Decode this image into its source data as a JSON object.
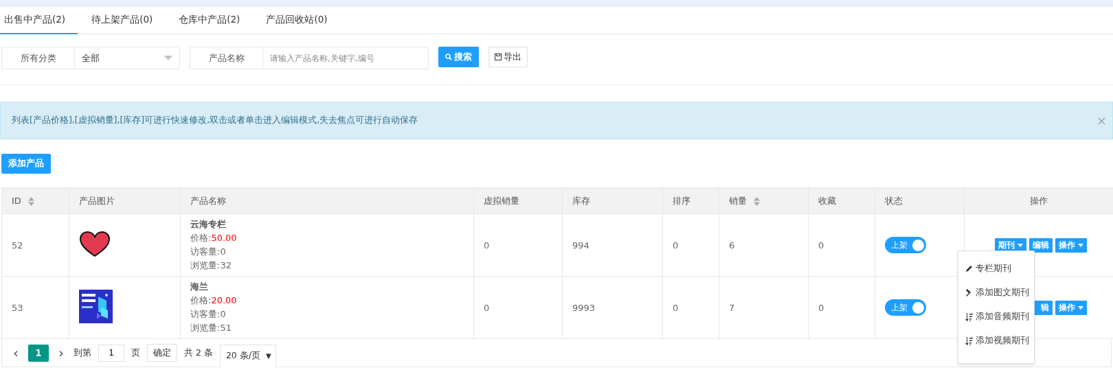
{
  "tabs": [
    {
      "label": "出售中产品(2)",
      "selected": true
    },
    {
      "label": "待上架产品(0)",
      "selected": false
    },
    {
      "label": "仓库中产品(2)",
      "selected": false
    },
    {
      "label": "产品回收站(0)",
      "selected": false
    }
  ],
  "filters": {
    "category_label": "所有分类",
    "category_value": "全部",
    "name_label": "产品名称",
    "name_placeholder": "请输入产品名称,关键字,编号",
    "search_button": "搜索",
    "export_button": "导出"
  },
  "alert": {
    "text": "列表[产品价格],[虚拟销量],[库存]可进行快速修改,双击或者单击进入编辑模式,失去焦点可进行自动保存",
    "close": "×"
  },
  "add_button": "添加产品",
  "table": {
    "columns": [
      {
        "label": "ID",
        "sortable": true
      },
      {
        "label": "产品图片",
        "sortable": false
      },
      {
        "label": "产品名称",
        "sortable": false
      },
      {
        "label": "虚拟销量",
        "sortable": false
      },
      {
        "label": "库存",
        "sortable": false
      },
      {
        "label": "排序",
        "sortable": false
      },
      {
        "label": "销量",
        "sortable": true
      },
      {
        "label": "收藏",
        "sortable": false
      },
      {
        "label": "状态",
        "sortable": false
      },
      {
        "label": "操作",
        "sortable": false
      }
    ],
    "rows": [
      {
        "id": "52",
        "title": "云海专栏",
        "price_label": "价格:",
        "price": "50.00",
        "visitors": "访客量:0",
        "views": "浏览量:32",
        "virtual_sales": "0",
        "stock": "994",
        "sort": "0",
        "sales": "6",
        "favorites": "0",
        "status": {
          "label": "上架",
          "on": true
        },
        "actions": [
          {
            "label": "期刊",
            "caret": true
          },
          {
            "label": "编辑",
            "caret": false
          },
          {
            "label": "操作",
            "caret": true
          }
        ]
      },
      {
        "id": "53",
        "title": "海兰",
        "price_label": "价格:",
        "price": "20.00",
        "visitors": "访客量:0",
        "views": "浏览量:51",
        "virtual_sales": "0",
        "stock": "9993",
        "sort": "0",
        "sales": "7",
        "favorites": "0",
        "status": {
          "label": "上架",
          "on": true
        },
        "actions": [
          {
            "label": "辑",
            "caret": false
          },
          {
            "label": "操作",
            "caret": true
          }
        ]
      }
    ]
  },
  "pager": {
    "prev": "‹",
    "current": "1",
    "next": "›",
    "goto_label": "到第",
    "goto_value": "1",
    "page_label": "页",
    "confirm": "确定",
    "total": "共 2 条",
    "page_size": "20 条/页",
    "page_size_caret": "▼"
  },
  "menu": {
    "items": [
      {
        "label": "专栏期刊"
      },
      {
        "label": "添加图文期刊"
      },
      {
        "label": "添加音频期刊"
      },
      {
        "label": "添加视频期刊"
      }
    ]
  }
}
